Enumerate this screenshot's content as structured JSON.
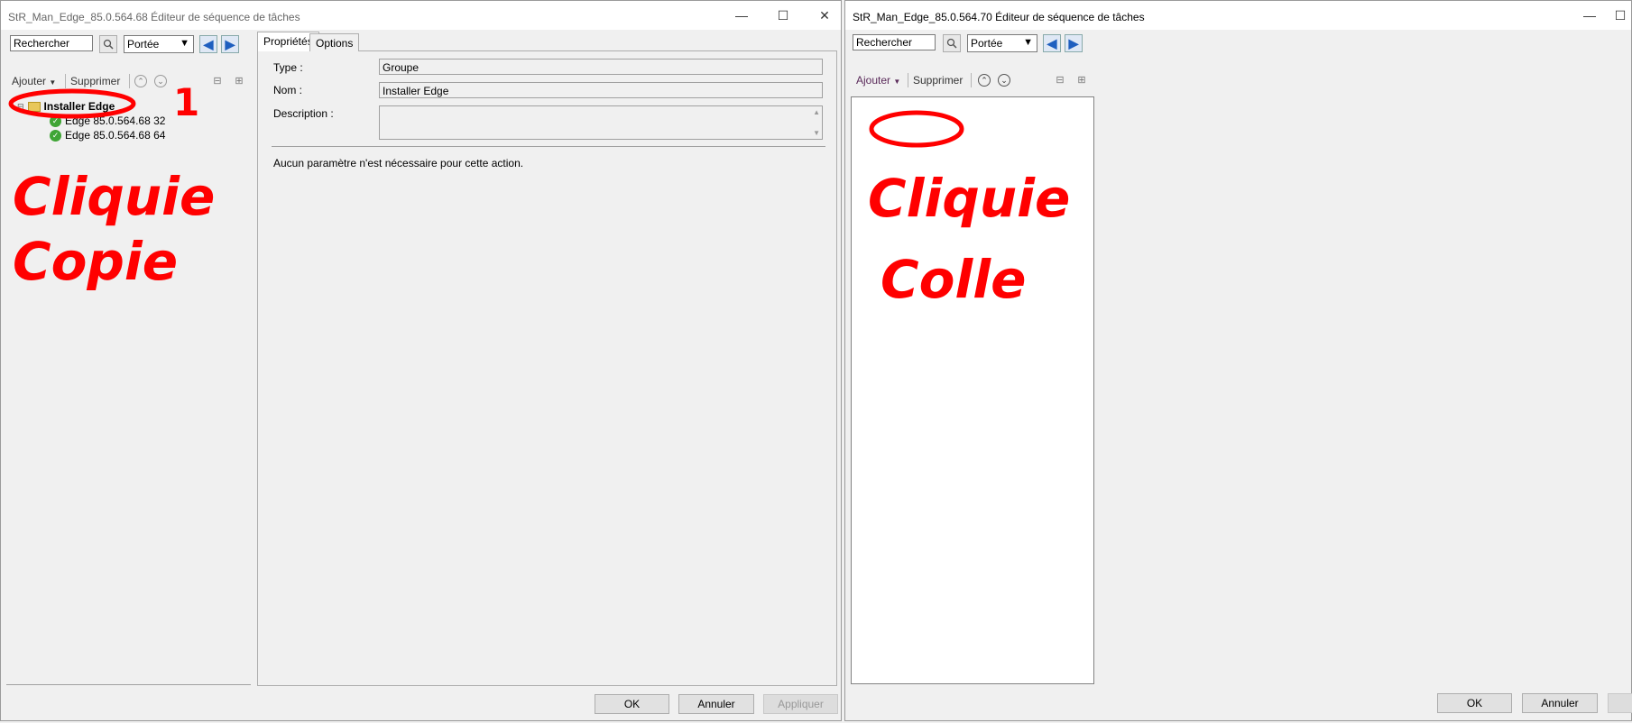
{
  "left_window": {
    "title": "StR_Man_Edge_85.0.564.68 Éditeur de séquence de tâches",
    "search_value": "Rechercher",
    "scope_value": "Portée",
    "toolbar": {
      "add_label": "Ajouter",
      "delete_label": "Supprimer"
    },
    "tree": {
      "group": "Installer Edge",
      "children": [
        "Edge 85.0.564.68 32",
        "Edge 85.0.564.68 64"
      ]
    },
    "tabs": [
      "Propriétés",
      "Options"
    ],
    "properties": {
      "type_label": "Type :",
      "type_value": "Groupe",
      "name_label": "Nom :",
      "name_value": "Installer Edge",
      "description_label": "Description :",
      "message": "Aucun paramètre n'est nécessaire pour cette action."
    },
    "buttons": {
      "ok": "OK",
      "cancel": "Annuler",
      "apply": "Appliquer"
    },
    "annotations": {
      "number": "1",
      "line1": "Cliquie",
      "line2": "Copie"
    }
  },
  "right_window": {
    "title": "StR_Man_Edge_85.0.564.70 Éditeur de séquence de tâches",
    "search_value": "Rechercher",
    "scope_value": "Portée",
    "toolbar": {
      "add_label": "Ajouter",
      "delete_label": "Supprimer"
    },
    "buttons": {
      "ok": "OK",
      "cancel": "Annuler"
    },
    "annotations": {
      "line1": "Cliquie",
      "line2": "Colle"
    }
  },
  "colors": {
    "annotation": "#ff0000",
    "titlebar": "#ffffff",
    "window_bg": "#f0f0f0"
  }
}
